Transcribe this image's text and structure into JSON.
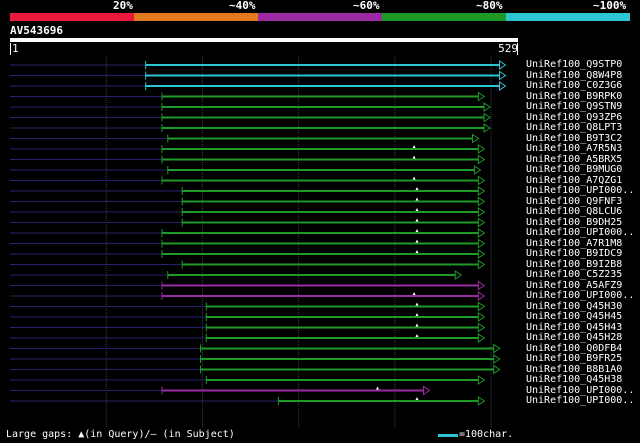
{
  "legend": {
    "labels": [
      "20%",
      "~40%",
      "~60%",
      "~80%",
      "~100%"
    ],
    "colors": [
      "#e8193a",
      "#e27a1d",
      "#9b2aa3",
      "#1e9a27",
      "#2ec5d3"
    ]
  },
  "query": {
    "name": "AV543696",
    "start": "1",
    "end": "529",
    "length": 529
  },
  "hits": [
    {
      "name": "UniRef100_Q9STP0",
      "start": 142,
      "end": 516,
      "color": "cyan",
      "gaps": []
    },
    {
      "name": "UniRef100_Q8W4P8",
      "start": 142,
      "end": 516,
      "color": "cyan",
      "gaps": []
    },
    {
      "name": "UniRef100_C0Z3G6",
      "start": 142,
      "end": 516,
      "color": "cyan",
      "gaps": []
    },
    {
      "name": "UniRef100_B9RPK0",
      "start": 159,
      "end": 494,
      "color": "green",
      "gaps": []
    },
    {
      "name": "UniRef100_Q9STN9",
      "start": 159,
      "end": 500,
      "color": "green",
      "gaps": []
    },
    {
      "name": "UniRef100_Q93ZP6",
      "start": 159,
      "end": 500,
      "color": "green",
      "gaps": []
    },
    {
      "name": "UniRef100_Q8LPT3",
      "start": 159,
      "end": 500,
      "color": "green",
      "gaps": []
    },
    {
      "name": "UniRef100_B9T3C2",
      "start": 165,
      "end": 488,
      "color": "green",
      "gaps": []
    },
    {
      "name": "UniRef100_A7R5N3",
      "start": 159,
      "end": 494,
      "color": "green",
      "gaps": [
        421
      ]
    },
    {
      "name": "UniRef100_A5BRX5",
      "start": 159,
      "end": 494,
      "color": "green",
      "gaps": [
        421
      ]
    },
    {
      "name": "UniRef100_B9MUG0",
      "start": 165,
      "end": 490,
      "color": "green",
      "gaps": []
    },
    {
      "name": "UniRef100_A7QZG1",
      "start": 159,
      "end": 494,
      "color": "green",
      "gaps": [
        421
      ]
    },
    {
      "name": "UniRef100_UPI000..",
      "start": 180,
      "end": 494,
      "color": "green",
      "gaps": [
        424
      ]
    },
    {
      "name": "UniRef100_Q9FNF3",
      "start": 180,
      "end": 494,
      "color": "green",
      "gaps": [
        424
      ]
    },
    {
      "name": "UniRef100_Q8LCU6",
      "start": 180,
      "end": 494,
      "color": "green",
      "gaps": [
        424
      ]
    },
    {
      "name": "UniRef100_B9DH25",
      "start": 180,
      "end": 494,
      "color": "green",
      "gaps": [
        424
      ]
    },
    {
      "name": "UniRef100_UPI000..",
      "start": 159,
      "end": 494,
      "color": "green",
      "gaps": [
        424
      ]
    },
    {
      "name": "UniRef100_A7R1M8",
      "start": 159,
      "end": 494,
      "color": "green",
      "gaps": [
        424
      ]
    },
    {
      "name": "UniRef100_B9IDC9",
      "start": 159,
      "end": 494,
      "color": "green",
      "gaps": [
        424
      ]
    },
    {
      "name": "UniRef100_B9I2B8",
      "start": 180,
      "end": 494,
      "color": "green",
      "gaps": []
    },
    {
      "name": "UniRef100_C5Z235",
      "start": 165,
      "end": 470,
      "color": "green",
      "gaps": []
    },
    {
      "name": "UniRef100_A5AFZ9",
      "start": 159,
      "end": 494,
      "color": "purple",
      "gaps": []
    },
    {
      "name": "UniRef100_UPI000..",
      "start": 159,
      "end": 494,
      "color": "purple",
      "gaps": [
        421
      ]
    },
    {
      "name": "UniRef100_Q45H30",
      "start": 205,
      "end": 494,
      "color": "green",
      "gaps": [
        424
      ]
    },
    {
      "name": "UniRef100_Q45H45",
      "start": 205,
      "end": 494,
      "color": "green",
      "gaps": [
        424
      ]
    },
    {
      "name": "UniRef100_Q45H43",
      "start": 205,
      "end": 494,
      "color": "green",
      "gaps": [
        424
      ]
    },
    {
      "name": "UniRef100_Q45H28",
      "start": 205,
      "end": 494,
      "color": "green",
      "gaps": [
        424
      ]
    },
    {
      "name": "UniRef100_Q0DFB4",
      "start": 199,
      "end": 510,
      "color": "green",
      "gaps": []
    },
    {
      "name": "UniRef100_B9FR25",
      "start": 199,
      "end": 510,
      "color": "green",
      "gaps": []
    },
    {
      "name": "UniRef100_B8B1A0",
      "start": 199,
      "end": 510,
      "color": "green",
      "gaps": []
    },
    {
      "name": "UniRef100_Q45H38",
      "start": 205,
      "end": 494,
      "color": "green",
      "gaps": []
    },
    {
      "name": "UniRef100_UPI000..",
      "start": 159,
      "end": 437,
      "color": "purple",
      "gaps": [
        383
      ]
    },
    {
      "name": "UniRef100_UPI000..",
      "start": 280,
      "end": 494,
      "color": "green",
      "gaps": [
        424
      ]
    }
  ],
  "footer": {
    "gaps_label": "Large gaps: ▲(in Query)/– (in Subject)",
    "scale_label": "=100char."
  }
}
